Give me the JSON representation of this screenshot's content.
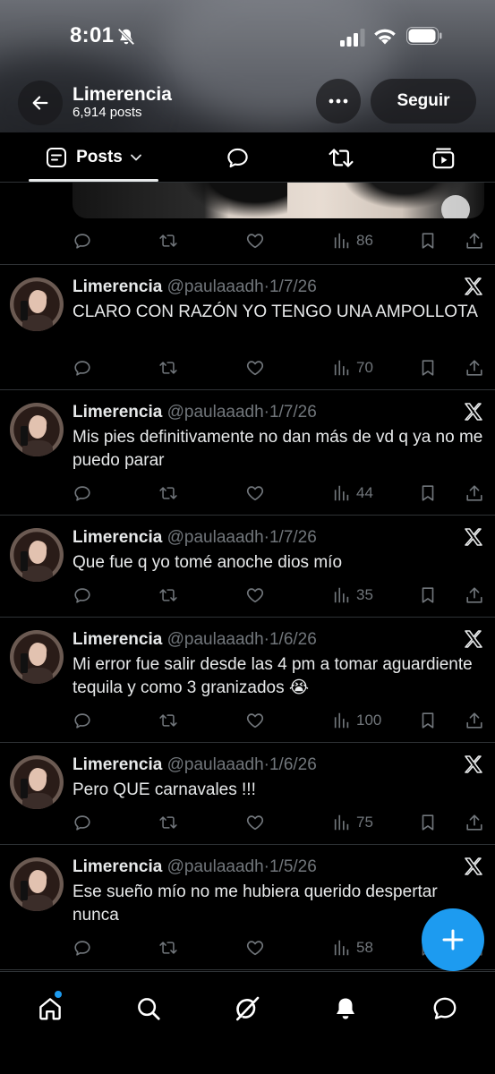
{
  "status_bar": {
    "time": "8:01",
    "icons": [
      "bell-off-icon",
      "signal-icon",
      "wifi-icon",
      "battery-icon"
    ]
  },
  "header": {
    "name": "Limerencia",
    "post_count": "6,914 posts",
    "follow_label": "Seguir",
    "icons": [
      "back-arrow-icon",
      "more-icon"
    ]
  },
  "tabs": {
    "posts_label": "Posts",
    "icons": [
      "posts-icon",
      "chevron-down-icon",
      "replies-icon",
      "reposts-icon",
      "media-icon"
    ]
  },
  "top_post": {
    "views": "86"
  },
  "tweets": [
    {
      "name": "Limerencia",
      "handle": "@paulaaadh",
      "date": "1/7/26",
      "text": "CLARO CON RAZÓN YO TENGO UNA AMPOLLOTA",
      "views": "70"
    },
    {
      "name": "Limerencia",
      "handle": "@paulaaadh",
      "date": "1/7/26",
      "text": "Mis pies definitivamente no dan más de vd q ya no me puedo parar",
      "views": "44"
    },
    {
      "name": "Limerencia",
      "handle": "@paulaaadh",
      "date": "1/7/26",
      "text": "Que fue q yo tomé anoche dios mío",
      "views": "35"
    },
    {
      "name": "Limerencia",
      "handle": "@paulaaadh",
      "date": "1/6/26",
      "text": "Mi error fue salir desde las 4 pm a tomar aguardiente tequila y como 3 granizados 😭",
      "views": "100"
    },
    {
      "name": "Limerencia",
      "handle": "@paulaaadh",
      "date": "1/6/26",
      "text": "Pero QUE carnavales !!!",
      "views": "75"
    },
    {
      "name": "Limerencia",
      "handle": "@paulaaadh",
      "date": "1/5/26",
      "text": "Ese sueño mío no me hubiera querido despertar nunca",
      "views": "58"
    }
  ],
  "bottom_nav": {
    "icons": [
      "home-icon",
      "search-icon",
      "grok-icon",
      "notifications-icon",
      "messages-icon"
    ]
  },
  "colors": {
    "background": "#000000",
    "text": "#e7e9ea",
    "muted": "#71767b",
    "accent": "#1d9bf0",
    "divider": "#2f3336"
  }
}
